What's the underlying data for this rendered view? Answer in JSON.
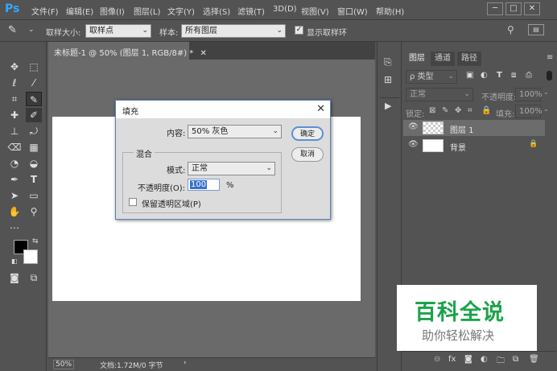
{
  "menubar": {
    "logo": "Ps",
    "items": [
      "文件(F)",
      "编辑(E)",
      "图像(I)",
      "图层(L)",
      "文字(Y)",
      "选择(S)",
      "滤镜(T)",
      "3D(D)",
      "视图(V)",
      "窗口(W)",
      "帮助(H)"
    ],
    "window_controls": [
      "─",
      "□",
      "✕"
    ]
  },
  "options": {
    "sample_size_label": "取样大小:",
    "sample_size_value": "取样点",
    "sample_label": "样本:",
    "sample_value": "所有图层",
    "show_ring_label": "显示取样环",
    "show_ring_checked": true
  },
  "document": {
    "tab_title": "未标题-1 @ 50% (图层 1, RGB/8#) *",
    "zoom": "50%",
    "doc_info": "文档:1.72M/0 字节"
  },
  "layers_panel": {
    "tabs": [
      "图层",
      "通道",
      "路径"
    ],
    "filter_label": "ρ 类型",
    "blend_mode": "正常",
    "opacity_label": "不透明度:",
    "opacity_value": "100%",
    "lock_label": "锁定:",
    "fill_label": "填充:",
    "fill_value": "100%",
    "layers": [
      {
        "name": "图层 1",
        "selected": true,
        "locked": false
      },
      {
        "name": "背景",
        "selected": false,
        "locked": true
      }
    ]
  },
  "dialog": {
    "title": "填充",
    "content_label": "内容:",
    "content_value": "50% 灰色",
    "ok_label": "确定",
    "cancel_label": "取消",
    "blend_group_label": "混合",
    "mode_label": "模式:",
    "mode_value": "正常",
    "opacity_label": "不透明度(O):",
    "opacity_value": "100",
    "opacity_unit": "%",
    "preserve_label": "保留透明区域(P)",
    "preserve_checked": false
  },
  "watermark": {
    "title": "百科全说",
    "subtitle": "助你轻松解决"
  },
  "colors": {
    "accent": "#31a8ff",
    "watermark_green": "#1aa34a",
    "panel_bg": "#535353"
  }
}
